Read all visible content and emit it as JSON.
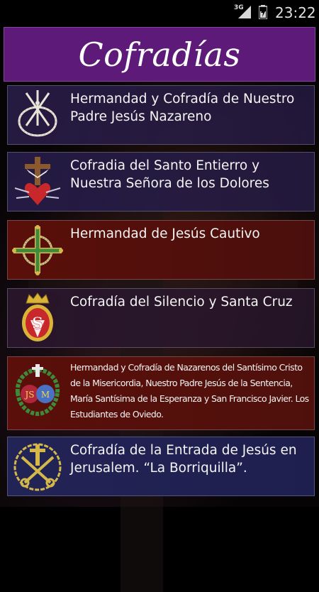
{
  "status_bar": {
    "network": "3G",
    "time": "23:22"
  },
  "header": {
    "title": "Cofradías"
  },
  "brotherhoods": [
    {
      "label": "Hermandad y Cofradía de Nuestro Padre Jesús Nazareno",
      "emblem": "crown-of-thorns-icon"
    },
    {
      "label": "Cofradia del Santo Entierro y Nuestra Señora de los Dolores",
      "emblem": "cross-and-heart-icon"
    },
    {
      "label": "Hermandad de Jesús Cautivo",
      "emblem": "green-cross-icon"
    },
    {
      "label": "Cofradía del Silencio y Santa Cruz",
      "emblem": "crowned-shield-icon"
    },
    {
      "label": "Hermandad y Cofradía de Nazarenos del Santísimo Cristo de la Misericordia, Nuestro Padre Jesús de la Sentencia, María Santísima de la Esperanza y San Francisco Javier. Los Estudiantes de Oviedo.",
      "emblem": "wreath-crest-icon"
    },
    {
      "label": "Cofradía de la Entrada de Jesús en Jerusalem. “La Borriquilla”.",
      "emblem": "keys-and-cross-icon"
    }
  ],
  "colors": {
    "title_banner": "#5e1a78",
    "item_purple": "#2a1c46",
    "item_red": "#5a0f0a",
    "item_blue": "#232456"
  }
}
